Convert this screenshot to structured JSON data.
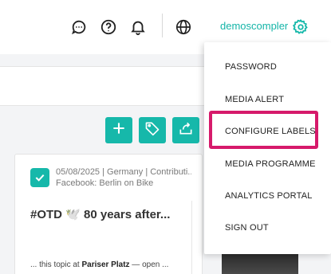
{
  "header": {
    "username": "demoscompler",
    "icons": [
      "chat-icon",
      "help-icon",
      "bell-icon",
      "globe-icon",
      "gear-icon"
    ]
  },
  "actions": [
    "add-icon",
    "tag-icon",
    "share-icon"
  ],
  "menu": {
    "items": [
      {
        "label": "PASSWORD"
      },
      {
        "label": "MEDIA ALERT"
      },
      {
        "label": "CONFIGURE LABELS"
      },
      {
        "label": "MEDIA PROGRAMME"
      },
      {
        "label": "ANALYTICS PORTAL"
      },
      {
        "label": "SIGN OUT"
      }
    ]
  },
  "card": {
    "meta_line1": "05/08/2025 | Germany | Contributi...",
    "meta_line2": "Facebook: Berlin on Bike",
    "headline": "#OTD 🕊️ 80 years after...",
    "body_prefix": "... this topic at ",
    "body_bold": "Pariser Platz",
    "body_suffix": " — open ..."
  },
  "colors": {
    "accent": "#16b8aa",
    "highlight": "#d61a6b"
  }
}
